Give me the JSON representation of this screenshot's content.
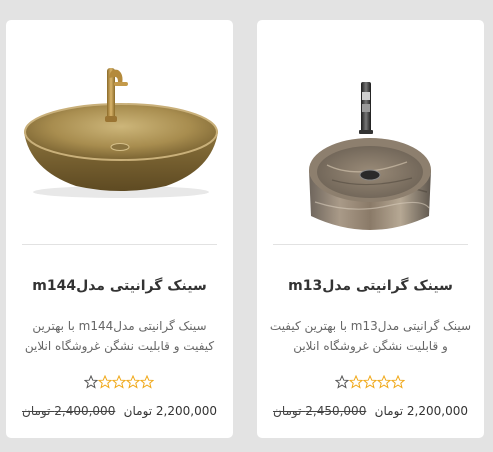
{
  "products": [
    {
      "title": "سینک گرانیتی مدلm144",
      "description": "سینک گرانیتی مدلm144 با بهترین کیفیت و قابلیت نشگن غروشگاه انلاین",
      "rating": 0,
      "rating_max": 5,
      "old_price": "2,400,000 تومان",
      "price": "2,200,000 تومان",
      "image_icon": "gold-oval-basin-sink"
    },
    {
      "title": "سینک گرانیتی مدلm13",
      "description": "سینک گرانیتی مدلm13 با بهترین کیفیت و قابلیت نشگن غروشگاه انلاین",
      "rating": 0,
      "rating_max": 5,
      "old_price": "2,450,000 تومان",
      "price": "2,200,000 تومان",
      "image_icon": "marble-round-basin-sink"
    }
  ],
  "colors": {
    "background": "#e3e3e3",
    "card": "#ffffff",
    "star_outline": "#f0a818",
    "star_first": "#555555"
  }
}
